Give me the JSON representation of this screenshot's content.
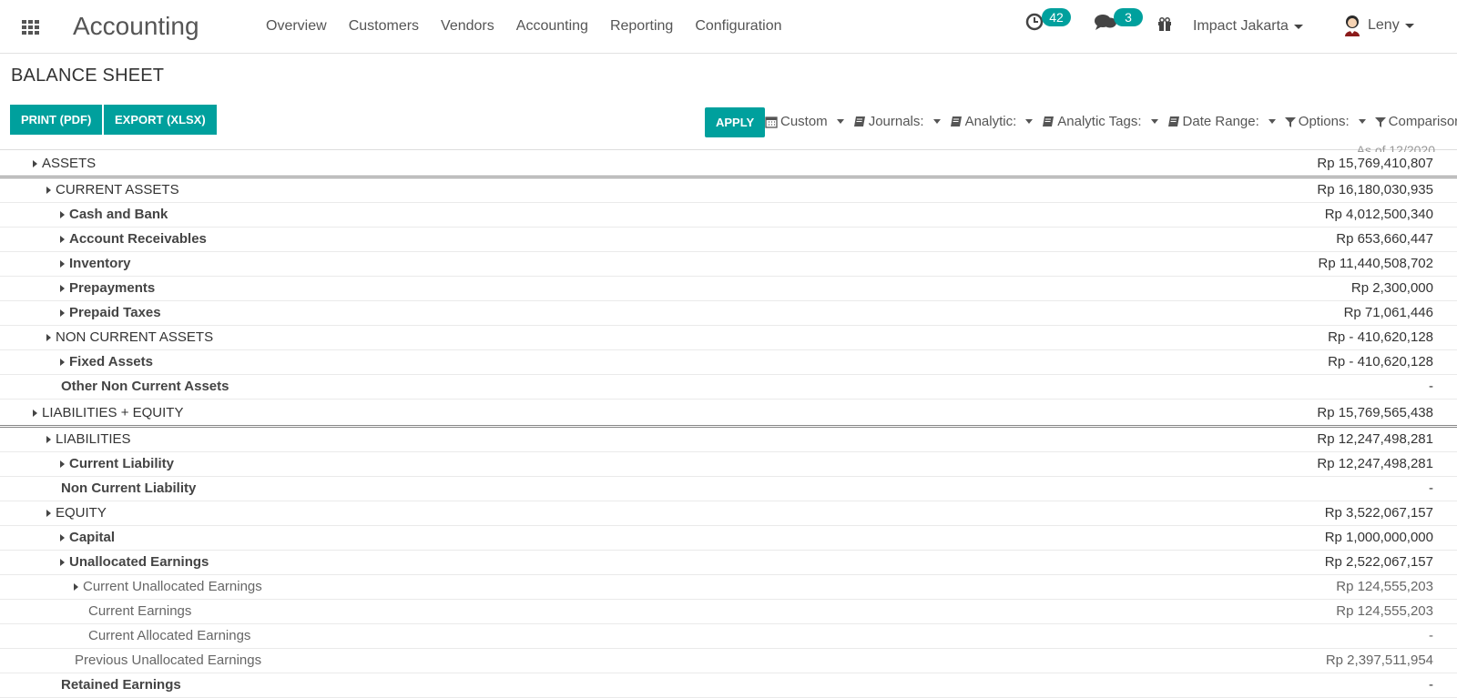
{
  "nav": {
    "app_title": "Accounting",
    "menu": [
      "Overview",
      "Customers",
      "Vendors",
      "Accounting",
      "Reporting",
      "Configuration"
    ],
    "activity_count": "42",
    "message_count": "3",
    "company": "Impact Jakarta",
    "user": "Leny"
  },
  "page": {
    "title": "BALANCE SHEET",
    "print_label": "PRINT (PDF)",
    "export_label": "EXPORT (XLSX)",
    "apply_label": "APPLY"
  },
  "filters": [
    "Custom",
    "Journals:",
    "Analytic:",
    "Analytic Tags:",
    "Date Range:",
    "Options:",
    "Comparison:"
  ],
  "column_header_cut": "As of 12/2020",
  "report": [
    {
      "label": "ASSETS",
      "amount": "Rp  15,769,410,807",
      "level": "l0",
      "style": "total",
      "expand": true
    },
    {
      "label": "CURRENT ASSETS",
      "amount": "Rp  16,180,030,935",
      "level": "l1",
      "style": "",
      "expand": true
    },
    {
      "label": "Cash and Bank",
      "amount": "Rp  4,012,500,340",
      "level": "l2",
      "style": "bold",
      "expand": true
    },
    {
      "label": "Account Receivables",
      "amount": "Rp  653,660,447",
      "level": "l2",
      "style": "bold",
      "expand": true
    },
    {
      "label": "Inventory",
      "amount": "Rp  11,440,508,702",
      "level": "l2",
      "style": "bold",
      "expand": true
    },
    {
      "label": "Prepayments",
      "amount": "Rp  2,300,000",
      "level": "l2",
      "style": "bold",
      "expand": true
    },
    {
      "label": "Prepaid Taxes",
      "amount": "Rp  71,061,446",
      "level": "l2",
      "style": "bold",
      "expand": true
    },
    {
      "label": "NON CURRENT ASSETS",
      "amount": "Rp - 410,620,128",
      "level": "l1",
      "style": "",
      "expand": true
    },
    {
      "label": "Fixed Assets",
      "amount": "Rp - 410,620,128",
      "level": "l2",
      "style": "bold",
      "expand": true
    },
    {
      "label": "Other Non Current Assets",
      "amount": "-",
      "level": "l2n",
      "style": "bold",
      "expand": false
    },
    {
      "label": "LIABILITIES + EQUITY",
      "amount": "Rp  15,769,565,438",
      "level": "l0",
      "style": "total",
      "expand": true
    },
    {
      "label": "LIABILITIES",
      "amount": "Rp  12,247,498,281",
      "level": "l1",
      "style": "",
      "expand": true
    },
    {
      "label": "Current Liability",
      "amount": "Rp  12,247,498,281",
      "level": "l2",
      "style": "bold",
      "expand": true
    },
    {
      "label": "Non Current Liability",
      "amount": "-",
      "level": "l2n",
      "style": "bold",
      "expand": false
    },
    {
      "label": "EQUITY",
      "amount": "Rp  3,522,067,157",
      "level": "l1",
      "style": "",
      "expand": true
    },
    {
      "label": "Capital",
      "amount": "Rp  1,000,000,000",
      "level": "l2",
      "style": "bold",
      "expand": true
    },
    {
      "label": "Unallocated Earnings",
      "amount": "Rp  2,522,067,157",
      "level": "l2",
      "style": "bold",
      "expand": true
    },
    {
      "label": "Current Unallocated Earnings",
      "amount": "Rp  124,555,203",
      "level": "l3",
      "style": "muted",
      "expand": true
    },
    {
      "label": "Current Earnings",
      "amount": "Rp  124,555,203",
      "level": "l3n",
      "style": "muted",
      "expand": false
    },
    {
      "label": "Current Allocated Earnings",
      "amount": "-",
      "level": "l3n",
      "style": "muted",
      "expand": false
    },
    {
      "label": "Previous Unallocated Earnings",
      "amount": "Rp  2,397,511,954",
      "level": "l3p",
      "style": "muted",
      "expand": false
    },
    {
      "label": "Retained Earnings",
      "amount": "-",
      "level": "l2n",
      "style": "bold",
      "expand": false
    }
  ],
  "colors": {
    "accent": "#00a09d"
  }
}
